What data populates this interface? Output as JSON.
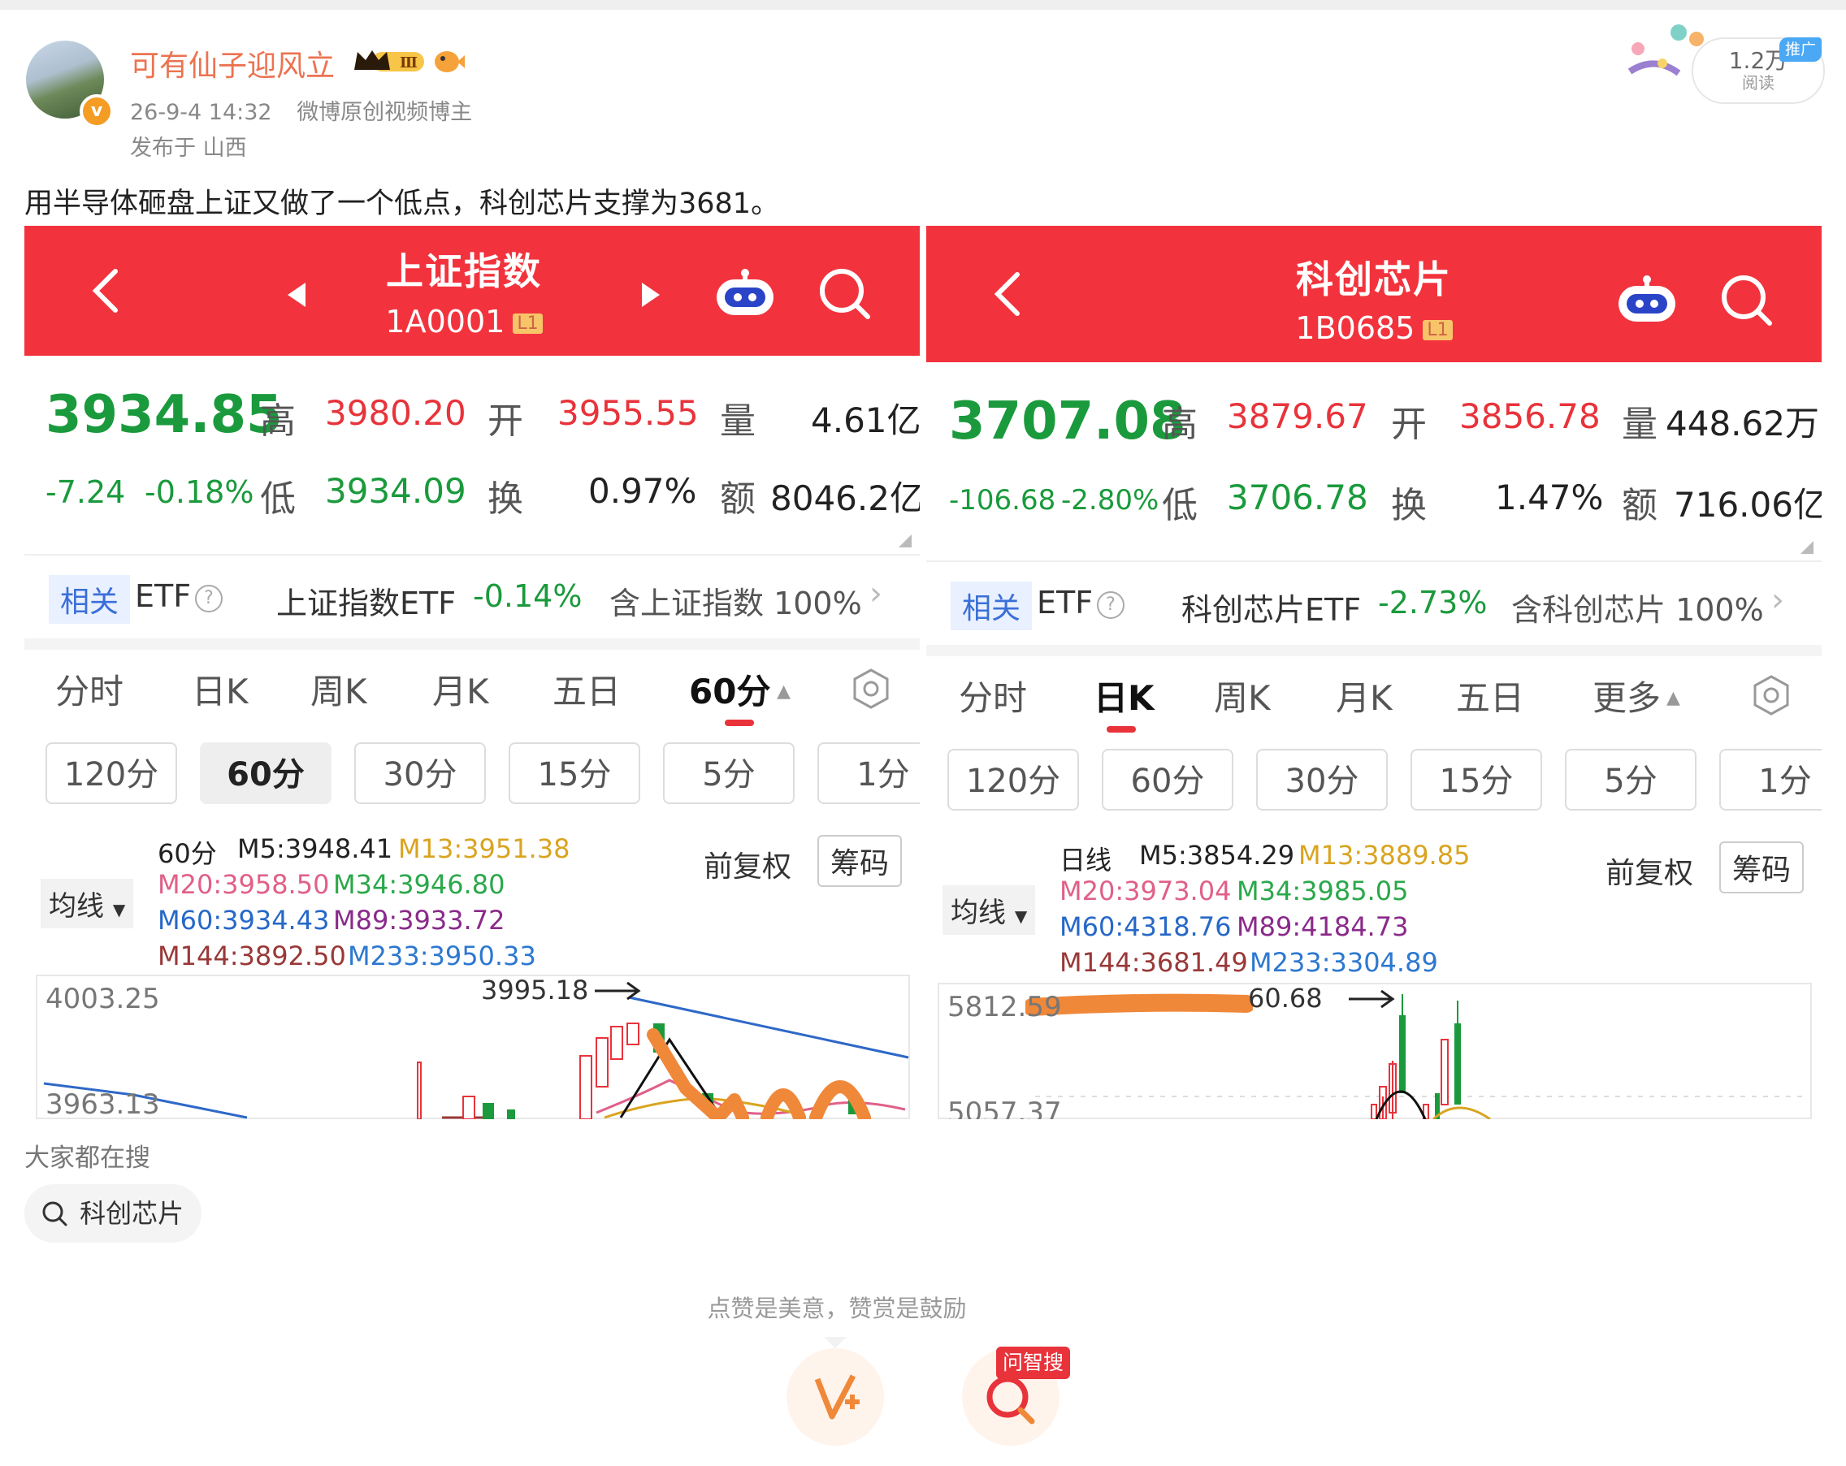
{
  "post": {
    "username": "可有仙子迎风立",
    "timestamp": "26-9-4 14:32",
    "role": "微博原创视频博主",
    "location": "发布于 山西",
    "reads_count": "1.2万",
    "reads_label": "阅读",
    "promo_label": "推广",
    "text": "用半导体砸盘上证又做了一个低点，科创芯片支撑为3681。"
  },
  "left": {
    "title": "上证指数",
    "code": "1A0001",
    "level": "L1",
    "price": "3934.85",
    "change": "-7.24",
    "change_pct": "-0.18%",
    "labels": {
      "high": "高",
      "open": "开",
      "volume": "量",
      "low": "低",
      "turnover": "换",
      "amount": "额"
    },
    "high": "3980.20",
    "open": "3955.55",
    "volume": "4.61亿",
    "low": "3934.09",
    "turnover": "0.97%",
    "amount": "8046.2亿",
    "etf_tag": "相关",
    "etf_word": "ETF",
    "etf_qmark": "?",
    "etf_name": "上证指数ETF",
    "etf_pct": "-0.14%",
    "etf_contain": "含上证指数 100%",
    "tabs": [
      "分时",
      "日K",
      "周K",
      "月K",
      "五日",
      "60分"
    ],
    "intervals": [
      "120分",
      "60分",
      "30分",
      "15分",
      "5分",
      "1分"
    ],
    "ma_select": "均线",
    "ma_row1": {
      "a": "60分",
      "b": "M5:3948.41",
      "c": "M13:3951.38"
    },
    "ma_row2": {
      "a": "M20:3958.50",
      "b": "M34:3946.80"
    },
    "ma_row3": {
      "a": "M60:3934.43",
      "b": "M89:3933.72"
    },
    "ma_row4": {
      "a": "M144:3892.50",
      "b": "M233:3950.33"
    },
    "adjust": "前复权",
    "chips": "筹码",
    "axis_top": "4003.25",
    "axis_bottom": "3963.13",
    "peak_label": "3995.18"
  },
  "right": {
    "title": "科创芯片",
    "code": "1B0685",
    "level": "L1",
    "price": "3707.08",
    "change": "-106.68",
    "change_pct": "-2.80%",
    "labels": {
      "high": "高",
      "open": "开",
      "volume": "量",
      "low": "低",
      "turnover": "换",
      "amount": "额"
    },
    "high": "3879.67",
    "open": "3856.78",
    "volume": "448.62万",
    "low": "3706.78",
    "turnover": "1.47%",
    "amount": "716.06亿",
    "etf_tag": "相关",
    "etf_word": "ETF",
    "etf_qmark": "?",
    "etf_name": "科创芯片ETF",
    "etf_pct": "-2.73%",
    "etf_contain": "含科创芯片 100%",
    "tabs": [
      "分时",
      "日K",
      "周K",
      "月K",
      "五日",
      "更多"
    ],
    "intervals": [
      "120分",
      "60分",
      "30分",
      "15分",
      "5分",
      "1分"
    ],
    "ma_select": "均线",
    "ma_row1": {
      "a": "日线",
      "b": "M5:3854.29",
      "c": "M13:3889.85"
    },
    "ma_row2": {
      "a": "M20:3973.04",
      "b": "M34:3985.05"
    },
    "ma_row3": {
      "a": "M60:4318.76",
      "b": "M89:4184.73"
    },
    "ma_row4": {
      "a": "M144:3681.49",
      "b": "M233:3304.89"
    },
    "adjust": "前复权",
    "chips": "筹码",
    "axis_top": "5812.59",
    "axis_bottom": "5057.37",
    "peak_label": "60.68"
  },
  "bottom": {
    "hot_title": "大家都在搜",
    "hot_query": "科创芯片",
    "tip": "点赞是美意，赞赏是鼓励",
    "ai_tag": "问智搜"
  },
  "colors": {
    "brand_red": "#f2333d",
    "up_red": "#e8333b",
    "down_green": "#1a9a3c",
    "username_orange": "#eb7350",
    "annotation_orange": "#f0883a"
  }
}
